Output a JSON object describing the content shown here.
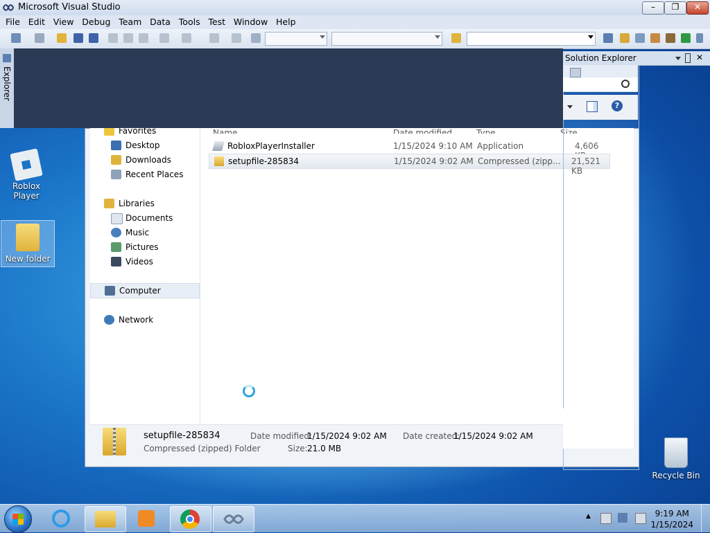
{
  "window": {
    "title": "Microsoft Visual Studio",
    "controls": {
      "minimize": "–",
      "maximize": "❐",
      "close": "✕"
    }
  },
  "menu": [
    "File",
    "Edit",
    "View",
    "Debug",
    "Team",
    "Data",
    "Tools",
    "Test",
    "Window",
    "Help"
  ],
  "toolbar": {
    "combo1_value": "",
    "combo2_value": "",
    "search_value": ""
  },
  "server_explorer": {
    "label": "Server Explorer"
  },
  "solution_explorer": {
    "title": "Solution Explorer",
    "pin": "📌",
    "close": "✕",
    "help": "?"
  },
  "explorer": {
    "columns": {
      "name": "Name",
      "date": "Date modified",
      "type": "Type",
      "size": "Size"
    },
    "nav": {
      "favorites": "Favorites",
      "favorites_items": [
        "Desktop",
        "Downloads",
        "Recent Places"
      ],
      "libraries": "Libraries",
      "libraries_items": [
        "Documents",
        "Music",
        "Pictures",
        "Videos"
      ],
      "computer": "Computer",
      "network": "Network"
    },
    "files": [
      {
        "name": "RobloxPlayerInstaller",
        "date": "1/15/2024 9:10 AM",
        "type": "Application",
        "size": "4,606 KB",
        "icon": "application-icon"
      },
      {
        "name": "setupfile-285834",
        "date": "1/15/2024 9:02 AM",
        "type": "Compressed (zipp...",
        "size": "21,521 KB",
        "icon": "zip-folder-icon"
      }
    ],
    "details": {
      "name": "setupfile-285834",
      "kind": "Compressed (zipped) Folder",
      "date_modified_label": "Date modified:",
      "date_modified": "1/15/2024 9:02 AM",
      "size_label": "Size:",
      "size": "21.0 MB",
      "date_created_label": "Date created:",
      "date_created": "1/15/2024 9:02 AM"
    }
  },
  "desktop": {
    "icons": [
      {
        "label": "Roblox Player"
      },
      {
        "label": "New folder"
      },
      {
        "label": "Recycle Bin"
      }
    ]
  },
  "taskbar": {
    "time": "9:19 AM",
    "date": "1/15/2024",
    "tray_arrow": "▲"
  },
  "colors": {
    "vs_dark": "#2b3a55",
    "desktop_blue": "#1a74c8",
    "selection": "#e3e8ef"
  }
}
